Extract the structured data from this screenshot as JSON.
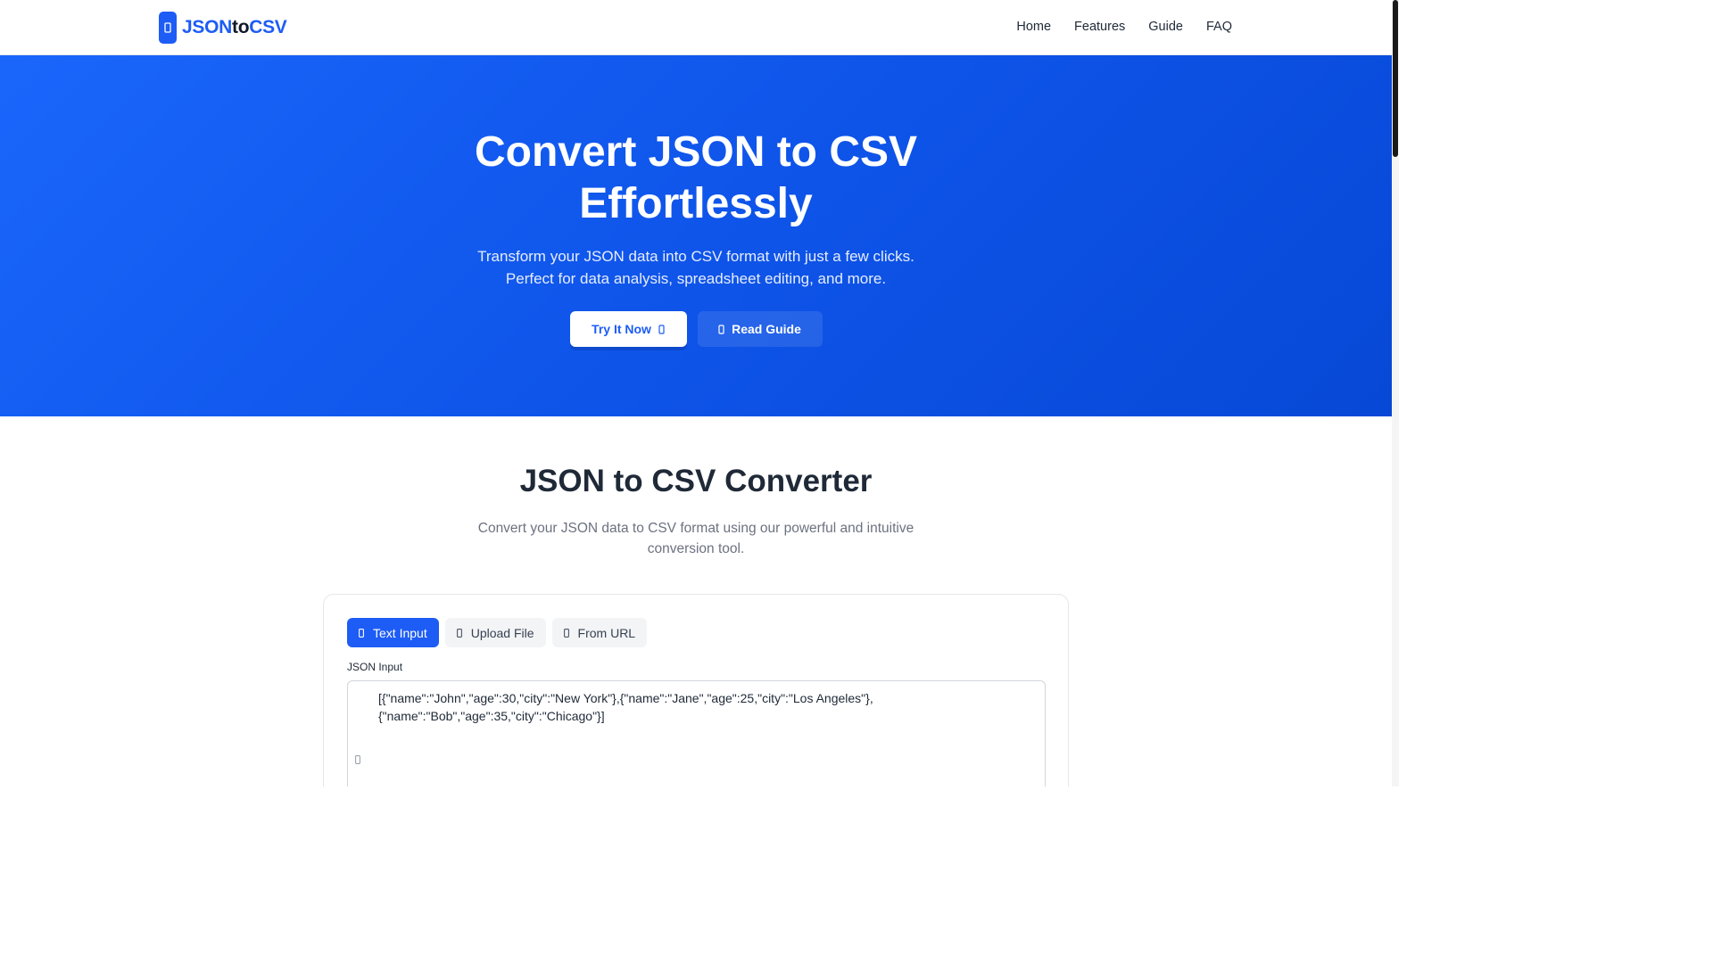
{
  "header": {
    "logo_part1": "JSON",
    "logo_part2": "to",
    "logo_part3": "CSV",
    "nav": [
      "Home",
      "Features",
      "Guide",
      "FAQ"
    ]
  },
  "hero": {
    "title_line1": "Convert JSON to CSV",
    "title_line2": "Effortlessly",
    "subtitle_line1": "Transform your JSON data into CSV format with just a few clicks.",
    "subtitle_line2": "Perfect for data analysis, spreadsheet editing, and more.",
    "primary_button": "Try It Now",
    "secondary_button": "Read Guide"
  },
  "converter": {
    "title": "JSON to CSV Converter",
    "subtitle_line1": "Convert your JSON data to CSV format using our powerful and intuitive",
    "subtitle_line2": "conversion tool.",
    "tabs": [
      "Text Input",
      "Upload File",
      "From URL"
    ],
    "active_tab": "Text Input",
    "input_label": "JSON Input",
    "input_value": "[{\"name\":\"John\",\"age\":30,\"city\":\"New York\"},{\"name\":\"Jane\",\"age\":25,\"city\":\"Los Angeles\"},\n{\"name\":\"Bob\",\"age\":35,\"city\":\"Chicago\"}]"
  },
  "colors": {
    "brand": "#1d5cf5",
    "hero_start": "#1a66fb",
    "hero_end": "#0748d6"
  }
}
